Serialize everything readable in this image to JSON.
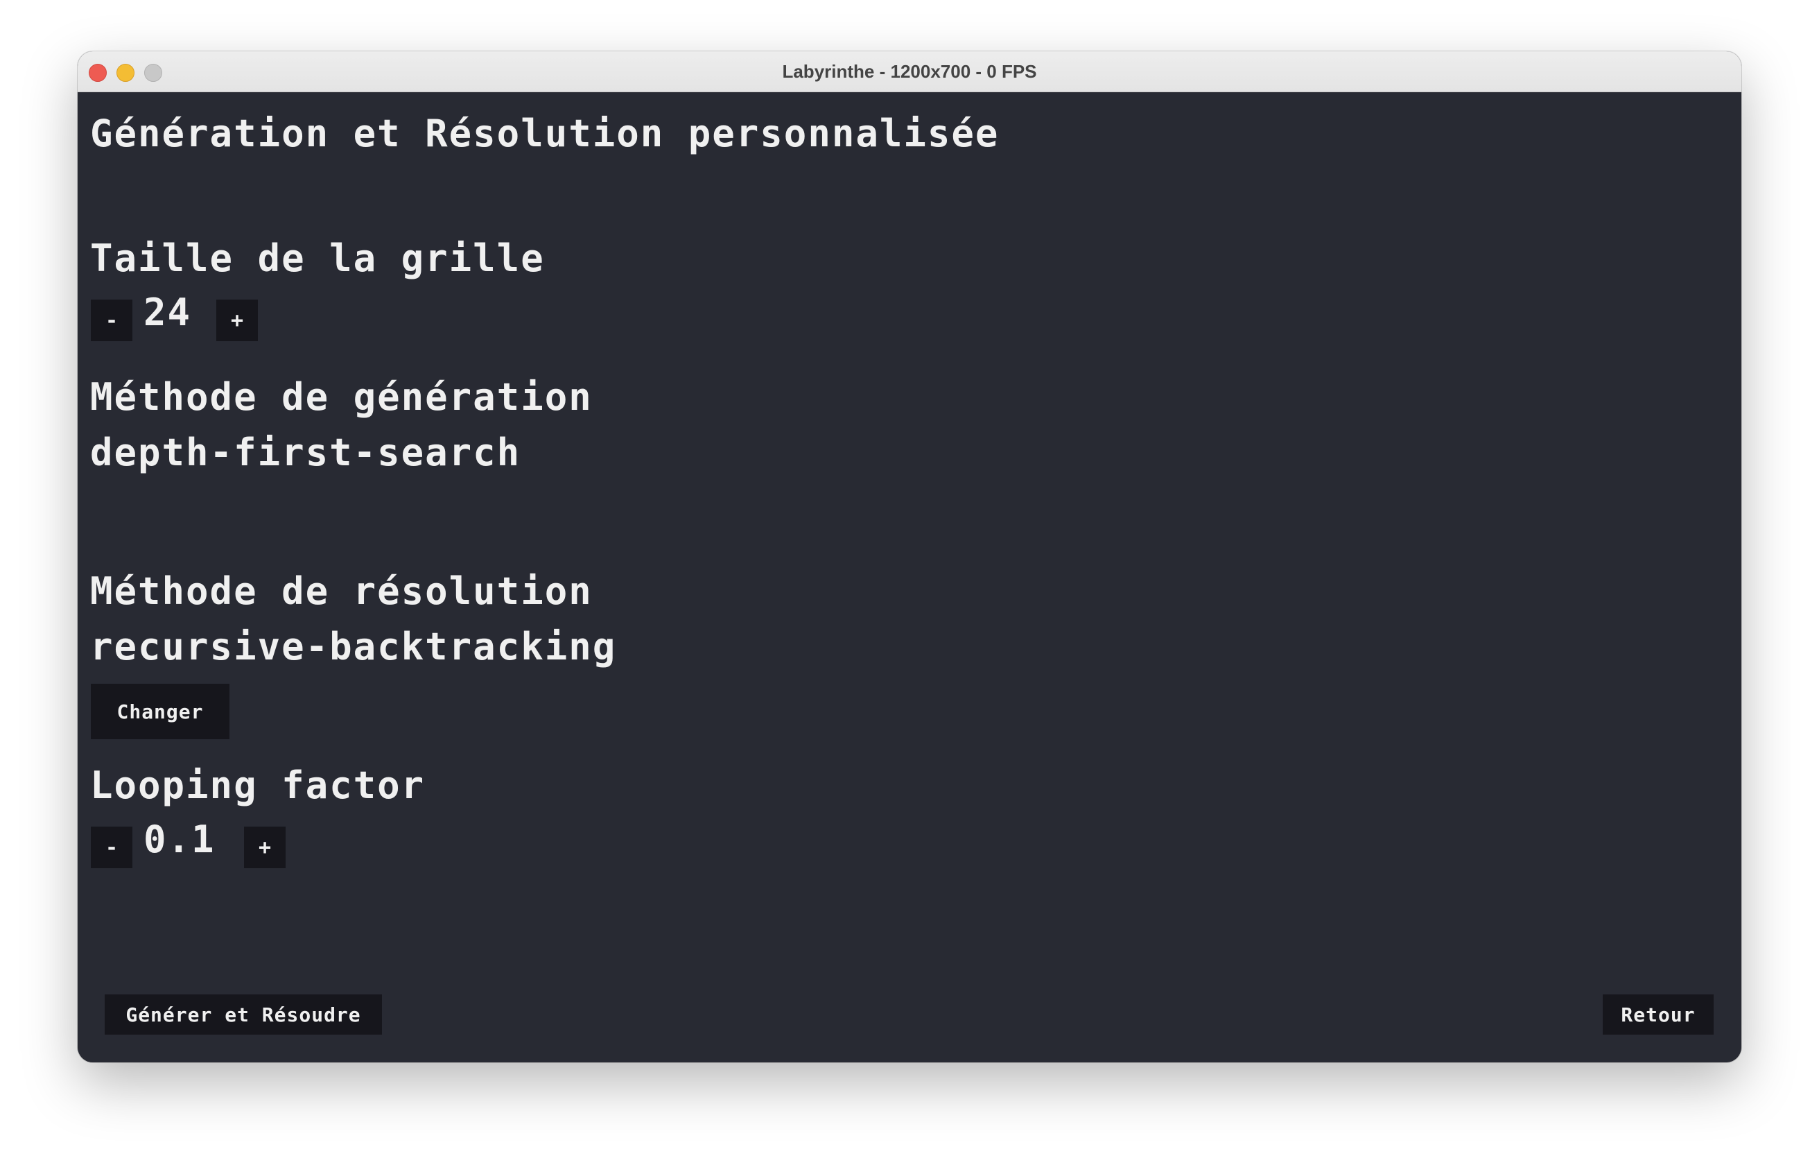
{
  "window": {
    "title": "Labyrinthe - 1200x700 - 0 FPS"
  },
  "page": {
    "title": "Génération et Résolution personnalisée"
  },
  "grid_size": {
    "label": "Taille de la grille",
    "decrement": "-",
    "value": "24",
    "increment": "+"
  },
  "generation": {
    "label": "Méthode de génération",
    "value": "depth-first-search"
  },
  "resolution": {
    "label": "Méthode de résolution",
    "value": "recursive-backtracking",
    "change_button": "Changer"
  },
  "looping": {
    "label": "Looping factor",
    "decrement": "-",
    "value": "0.1",
    "increment": "+"
  },
  "actions": {
    "generate_button": "Générer et Résoudre",
    "back_button": "Retour"
  },
  "colors": {
    "background": "#282a33",
    "button": "#16161c",
    "text": "#f0f0f0"
  }
}
